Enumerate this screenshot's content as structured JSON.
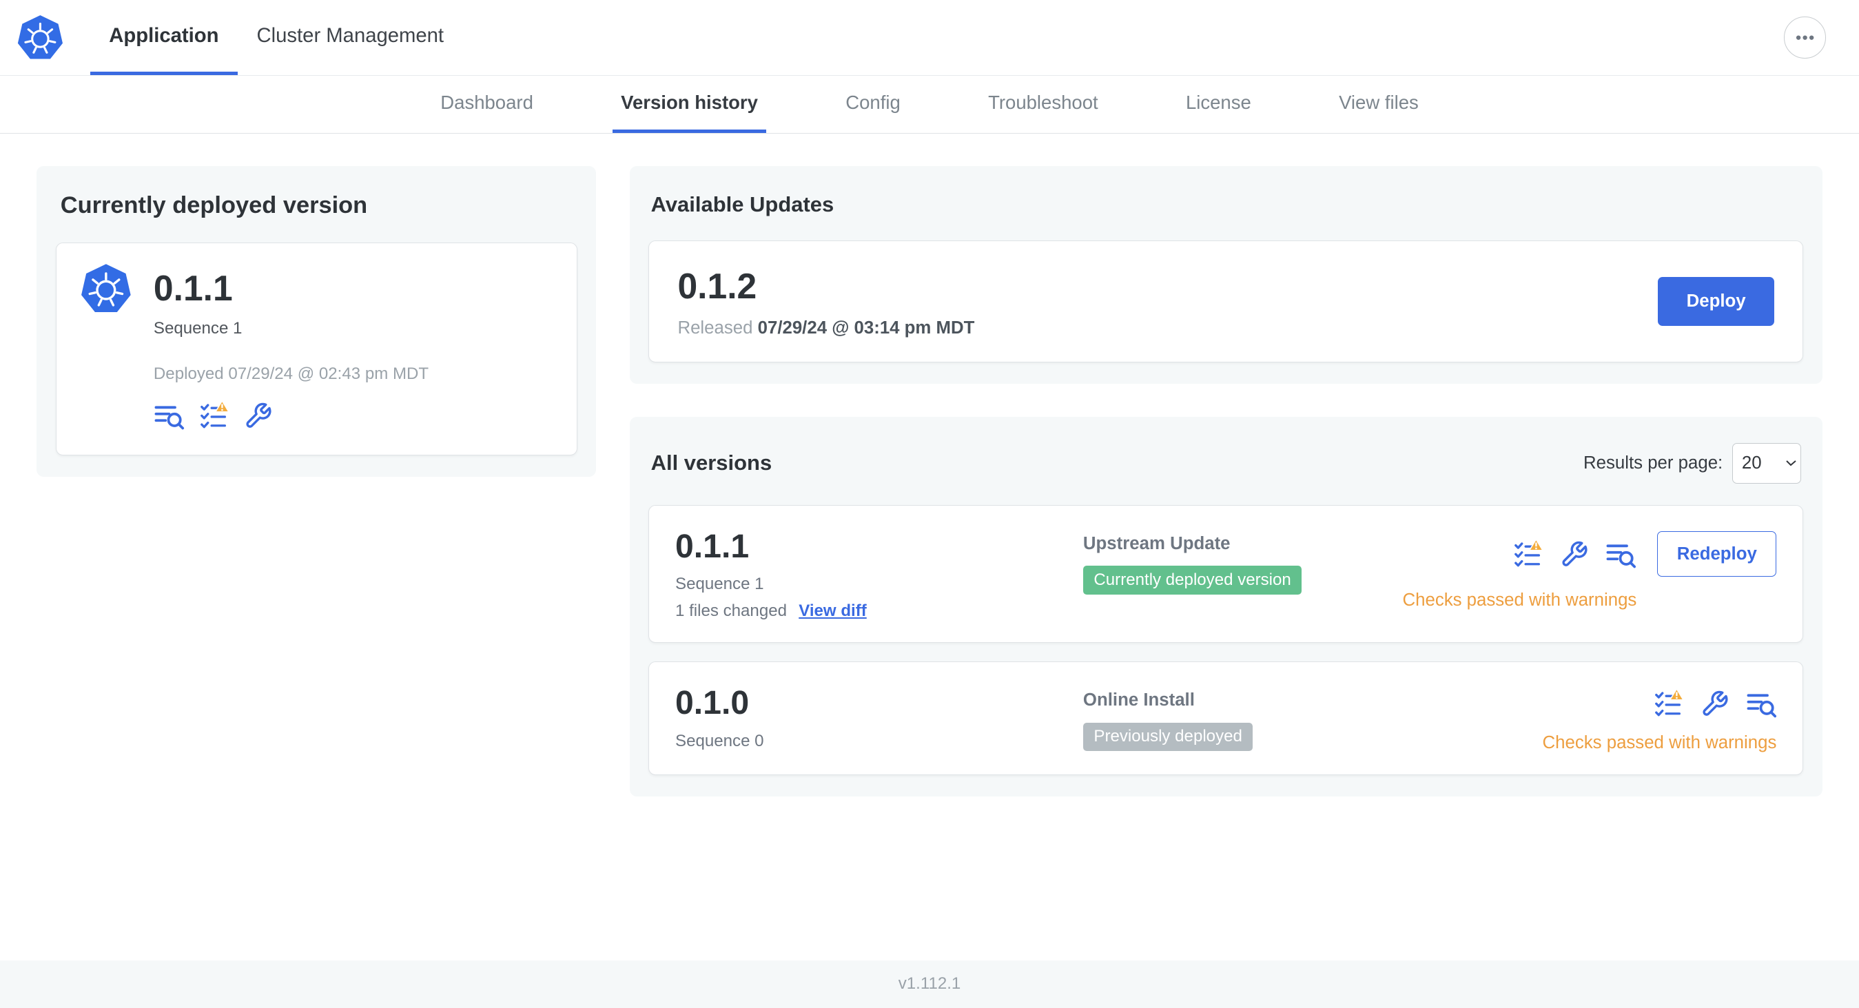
{
  "header": {
    "tabs": [
      {
        "label": "Application",
        "active": true
      },
      {
        "label": "Cluster Management",
        "active": false
      }
    ]
  },
  "subnav": {
    "items": [
      {
        "label": "Dashboard",
        "active": false
      },
      {
        "label": "Version history",
        "active": true
      },
      {
        "label": "Config",
        "active": false
      },
      {
        "label": "Troubleshoot",
        "active": false
      },
      {
        "label": "License",
        "active": false
      },
      {
        "label": "View files",
        "active": false
      }
    ]
  },
  "current_version": {
    "title": "Currently deployed version",
    "version": "0.1.1",
    "sequence": "Sequence 1",
    "deployed": "Deployed 07/29/24 @ 02:43 pm MDT"
  },
  "available_updates": {
    "title": "Available Updates",
    "version": "0.1.2",
    "released_prefix": "Released",
    "released_date": "07/29/24 @ 03:14 pm MDT",
    "deploy_label": "Deploy"
  },
  "all_versions": {
    "title": "All versions",
    "results_per_page_label": "Results per page:",
    "results_per_page_value": "20",
    "rows": [
      {
        "version": "0.1.1",
        "sequence": "Sequence 1",
        "files_changed": "1 files changed",
        "view_diff": "View diff",
        "source": "Upstream Update",
        "badge": "Currently deployed version",
        "badge_type": "green",
        "status": "Checks passed with warnings",
        "action": "Redeploy"
      },
      {
        "version": "0.1.0",
        "sequence": "Sequence 0",
        "source": "Online Install",
        "badge": "Previously deployed",
        "badge_type": "gray",
        "status": "Checks passed with warnings"
      }
    ]
  },
  "footer": {
    "version": "v1.112.1"
  },
  "icons": {
    "logo": "kubernetes-logo",
    "header_more": "ellipsis-icon",
    "deployed_card_actions": [
      "logs-magnifier-icon",
      "preflight-checklist-warning-icon",
      "analyze-wrench-icon"
    ],
    "version_row_actions": [
      "preflight-checklist-warning-icon",
      "analyze-wrench-icon",
      "logs-magnifier-icon"
    ]
  },
  "colors": {
    "accent_blue": "#3a6ae1",
    "logo_blue": "#326ce5",
    "warning_text": "#ed9e3f",
    "warning_triangle": "#f3ac3c",
    "badge_green": "#62c08d",
    "badge_gray": "#b4bcc1",
    "panel_bg": "#f5f8f9"
  }
}
